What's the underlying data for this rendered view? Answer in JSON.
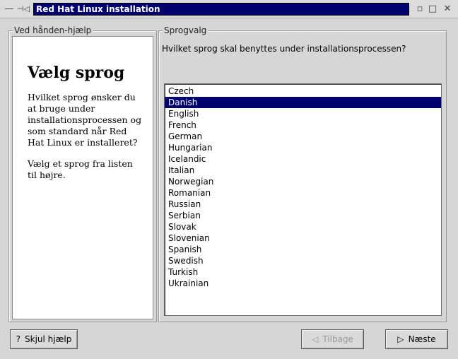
{
  "window": {
    "title": "Red Hat Linux installation",
    "menu_glyph": "—",
    "pin_glyph": "⊣◁",
    "min_glyph": "▫",
    "max_glyph": "□",
    "close_glyph": "✕"
  },
  "help": {
    "legend": "Ved hånden-hjælp",
    "title": "Vælg sprog",
    "paragraph1": "Hvilket sprog ønsker du at bruge under installationsprocessen og som standard når Red Hat Linux er installeret?",
    "paragraph2": "Vælg et sprog fra listen til højre."
  },
  "language": {
    "legend": "Sprogvalg",
    "question": "Hvilket sprog skal benyttes under installationsprocessen?",
    "selected": "Danish",
    "items": [
      "Czech",
      "Danish",
      "English",
      "French",
      "German",
      "Hungarian",
      "Icelandic",
      "Italian",
      "Norwegian",
      "Romanian",
      "Russian",
      "Serbian",
      "Slovak",
      "Slovenian",
      "Spanish",
      "Swedish",
      "Turkish",
      "Ukrainian"
    ]
  },
  "buttons": {
    "hide_help": "Skjul hjælp",
    "hide_help_icon": "?",
    "back": "Tilbage",
    "back_icon": "◁",
    "next": "Næste",
    "next_icon": "▷"
  },
  "colors": {
    "selection": "#00006e",
    "title_bar_active": "#00006e",
    "background": "#d6d6d6"
  }
}
